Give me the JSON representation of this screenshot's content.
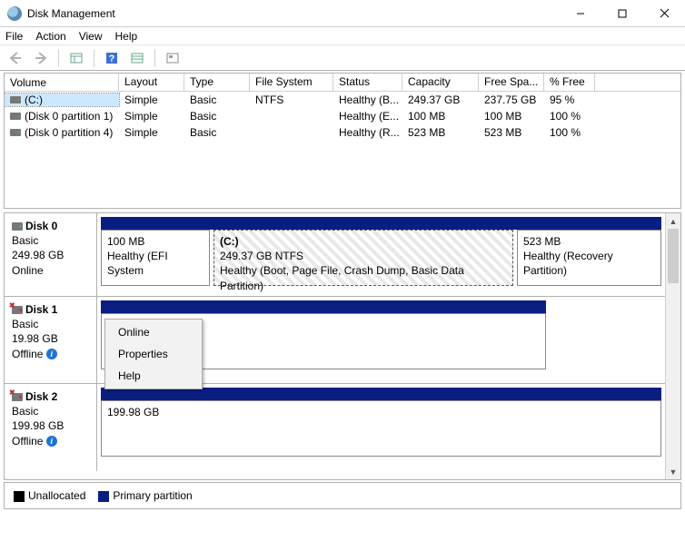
{
  "title": "Disk Management",
  "menu": {
    "file": "File",
    "action": "Action",
    "view": "View",
    "help": "Help"
  },
  "columns": {
    "volume": "Volume",
    "layout": "Layout",
    "type": "Type",
    "fs": "File System",
    "status": "Status",
    "capacity": "Capacity",
    "free": "Free Spa...",
    "pct": "% Free"
  },
  "volumes": {
    "r0": {
      "name": "(C:)",
      "layout": "Simple",
      "type": "Basic",
      "fs": "NTFS",
      "status": "Healthy (B...",
      "cap": "249.37 GB",
      "free": "237.75 GB",
      "pct": "95 %"
    },
    "r1": {
      "name": "(Disk 0 partition 1)",
      "layout": "Simple",
      "type": "Basic",
      "fs": "",
      "status": "Healthy (E...",
      "cap": "100 MB",
      "free": "100 MB",
      "pct": "100 %"
    },
    "r2": {
      "name": "(Disk 0 partition 4)",
      "layout": "Simple",
      "type": "Basic",
      "fs": "",
      "status": "Healthy (R...",
      "cap": "523 MB",
      "free": "523 MB",
      "pct": "100 %"
    }
  },
  "disks": {
    "d0": {
      "name": "Disk 0",
      "type": "Basic",
      "size": "249.98 GB",
      "state": "Online"
    },
    "d1": {
      "name": "Disk 1",
      "type": "Basic",
      "size": "19.98 GB",
      "state": "Offline"
    },
    "d2": {
      "name": "Disk 2",
      "type": "Basic",
      "size": "199.98 GB",
      "state": "Offline"
    }
  },
  "partitions": {
    "d0p0": {
      "size": "100 MB",
      "desc": "Healthy (EFI System"
    },
    "d0p1": {
      "name": "(C:)",
      "size": "249.37 GB NTFS",
      "desc": "Healthy (Boot, Page File, Crash Dump, Basic Data Partition)"
    },
    "d0p2": {
      "size": "523 MB",
      "desc": "Healthy (Recovery Partition)"
    },
    "d2p0": {
      "size": "199.98 GB"
    }
  },
  "context": {
    "online": "Online",
    "properties": "Properties",
    "help": "Help"
  },
  "legend": {
    "unalloc": "Unallocated",
    "primary": "Primary partition"
  }
}
